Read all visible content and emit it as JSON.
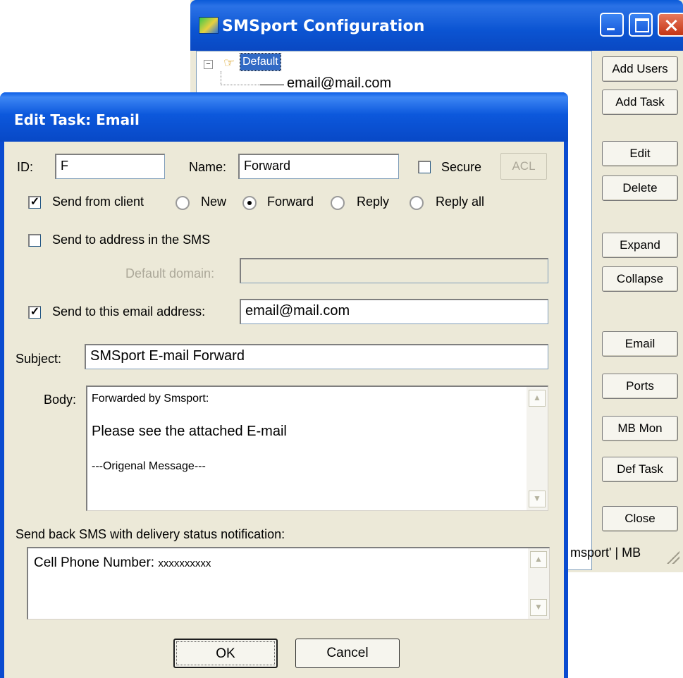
{
  "main_window": {
    "title": "SMSport Configuration",
    "tree": {
      "root_label": "Default",
      "expander": "⊟",
      "child_label": "email@mail.com"
    },
    "buttons": [
      {
        "label": "Add Users"
      },
      {
        "label": "Add Task"
      },
      {
        "label": "Edit"
      },
      {
        "label": "Delete"
      },
      {
        "label": "Expand"
      },
      {
        "label": "Collapse"
      },
      {
        "label": "Email"
      },
      {
        "label": "Ports"
      },
      {
        "label": "MB Mon"
      },
      {
        "label": "Def Task"
      },
      {
        "label": "Close"
      }
    ],
    "status_text": "msport'  |  MB"
  },
  "dialog": {
    "title": "Edit Task: Email",
    "id_label": "ID:",
    "id_value": "F",
    "name_label": "Name:",
    "name_value": "Forward",
    "secure_label": "Secure",
    "secure_checked": false,
    "acl_label": "ACL",
    "send_from_client_label": "Send from client",
    "send_from_client_checked": true,
    "radio_options": [
      {
        "label": "New",
        "selected": false
      },
      {
        "label": "Forward",
        "selected": true
      },
      {
        "label": "Reply",
        "selected": false
      },
      {
        "label": "Reply all",
        "selected": false
      }
    ],
    "send_to_sms_address_label": "Send to address in the SMS",
    "send_to_sms_address_checked": false,
    "default_domain_label": "Default domain:",
    "default_domain_value": "",
    "send_to_email_label": "Send to this email address:",
    "send_to_email_checked": true,
    "send_to_email_value": "email@mail.com",
    "subject_label": "Subject:",
    "subject_value": "SMSport E-mail Forward",
    "body_label": "Body:",
    "body_lines": [
      "Forwarded by Smsport:",
      "Please see the attached E-mail",
      "---Origenal Message---"
    ],
    "sendback_label": "Send back SMS with delivery status notification:",
    "sendback_prefix": "Cell Phone Number: ",
    "sendback_number": "xxxxxxxxxx",
    "ok_label": "OK",
    "cancel_label": "Cancel"
  },
  "colors": {
    "titlebar_blue": "#0a54d6",
    "window_face": "#ece9d8",
    "selection": "#316ac5"
  },
  "icons": {
    "app": "smsport-app-icon",
    "tree_pointer": "pointing-hand-icon",
    "scroll_up": "chevron-up-icon",
    "scroll_down": "chevron-down-icon"
  }
}
